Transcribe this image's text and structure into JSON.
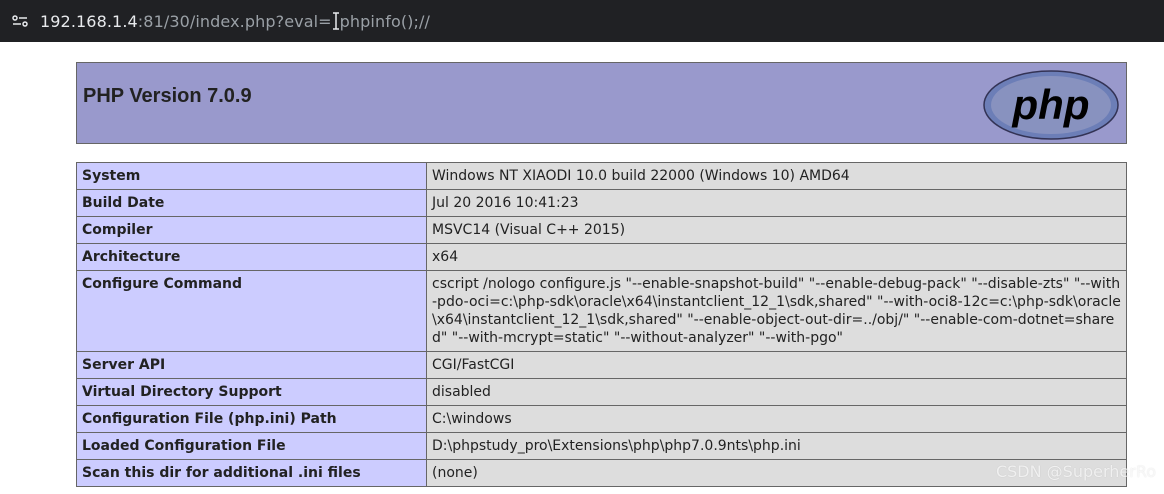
{
  "browser": {
    "url_host": "192.168.1.4",
    "url_rest": ":81/30/index.php?eval=",
    "url_after_cursor": "phpinfo();//"
  },
  "header": {
    "title": "PHP Version 7.0.9",
    "logo_text": "php"
  },
  "rows": [
    {
      "key": "System",
      "value": "Windows NT XIAODI 10.0 build 22000 (Windows 10) AMD64"
    },
    {
      "key": "Build Date",
      "value": "Jul 20 2016 10:41:23"
    },
    {
      "key": "Compiler",
      "value": "MSVC14 (Visual C++ 2015)"
    },
    {
      "key": "Architecture",
      "value": "x64"
    },
    {
      "key": "Configure Command",
      "value": "cscript /nologo configure.js \"--enable-snapshot-build\" \"--enable-debug-pack\" \"--disable-zts\" \"--with-pdo-oci=c:\\php-sdk\\oracle\\x64\\instantclient_12_1\\sdk,shared\" \"--with-oci8-12c=c:\\php-sdk\\oracle\\x64\\instantclient_12_1\\sdk,shared\" \"--enable-object-out-dir=../obj/\" \"--enable-com-dotnet=shared\" \"--with-mcrypt=static\" \"--without-analyzer\" \"--with-pgo\""
    },
    {
      "key": "Server API",
      "value": "CGI/FastCGI"
    },
    {
      "key": "Virtual Directory Support",
      "value": "disabled"
    },
    {
      "key": "Configuration File (php.ini) Path",
      "value": "C:\\windows"
    },
    {
      "key": "Loaded Configuration File",
      "value": "D:\\phpstudy_pro\\Extensions\\php\\php7.0.9nts\\php.ini"
    },
    {
      "key": "Scan this dir for additional .ini files",
      "value": "(none)"
    }
  ],
  "watermark": "CSDN @SuperherRo",
  "colors": {
    "header_bg": "#9999cc",
    "key_bg": "#ccccff",
    "value_bg": "#dddddd",
    "border": "#666666",
    "urlbar_bg": "#202124"
  }
}
